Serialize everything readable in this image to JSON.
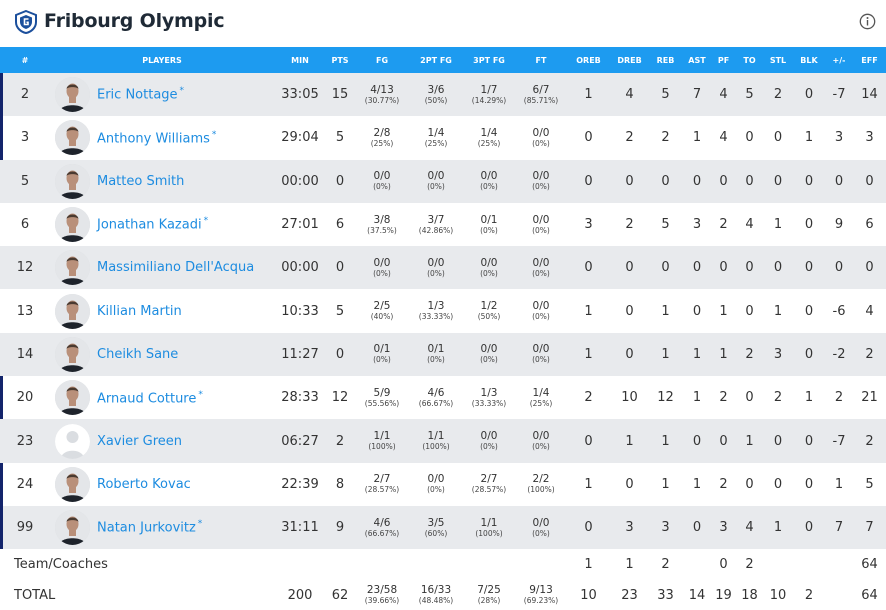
{
  "header": {
    "team_name": "Fribourg Olympic"
  },
  "columns": [
    "#",
    "PLAYERS",
    "MIN",
    "PTS",
    "FG",
    "2PT FG",
    "3PT FG",
    "FT",
    "OREB",
    "DREB",
    "REB",
    "AST",
    "PF",
    "TO",
    "STL",
    "BLK",
    "+/-",
    "EFF"
  ],
  "players": [
    {
      "no": "2",
      "name": "Eric Nottage",
      "starter": true,
      "star": "*",
      "min": "33:05",
      "pts": "15",
      "fg": "4/13",
      "fg_pct": "(30.77%)",
      "fg2": "3/6",
      "fg2_pct": "(50%)",
      "fg3": "1/7",
      "fg3_pct": "(14.29%)",
      "ft": "6/7",
      "ft_pct": "(85.71%)",
      "oreb": "1",
      "dreb": "4",
      "reb": "5",
      "ast": "7",
      "pf": "4",
      "to": "5",
      "stl": "2",
      "blk": "0",
      "pm": "-7",
      "eff": "14"
    },
    {
      "no": "3",
      "name": "Anthony Williams",
      "starter": true,
      "star": "*",
      "min": "29:04",
      "pts": "5",
      "fg": "2/8",
      "fg_pct": "(25%)",
      "fg2": "1/4",
      "fg2_pct": "(25%)",
      "fg3": "1/4",
      "fg3_pct": "(25%)",
      "ft": "0/0",
      "ft_pct": "(0%)",
      "oreb": "0",
      "dreb": "2",
      "reb": "2",
      "ast": "1",
      "pf": "4",
      "to": "0",
      "stl": "0",
      "blk": "1",
      "pm": "3",
      "eff": "3"
    },
    {
      "no": "5",
      "name": "Matteo Smith",
      "starter": false,
      "star": "",
      "min": "00:00",
      "pts": "0",
      "fg": "0/0",
      "fg_pct": "(0%)",
      "fg2": "0/0",
      "fg2_pct": "(0%)",
      "fg3": "0/0",
      "fg3_pct": "(0%)",
      "ft": "0/0",
      "ft_pct": "(0%)",
      "oreb": "0",
      "dreb": "0",
      "reb": "0",
      "ast": "0",
      "pf": "0",
      "to": "0",
      "stl": "0",
      "blk": "0",
      "pm": "0",
      "eff": "0"
    },
    {
      "no": "6",
      "name": "Jonathan Kazadi",
      "starter": false,
      "star": "*",
      "min": "27:01",
      "pts": "6",
      "fg": "3/8",
      "fg_pct": "(37.5%)",
      "fg2": "3/7",
      "fg2_pct": "(42.86%)",
      "fg3": "0/1",
      "fg3_pct": "(0%)",
      "ft": "0/0",
      "ft_pct": "(0%)",
      "oreb": "3",
      "dreb": "2",
      "reb": "5",
      "ast": "3",
      "pf": "2",
      "to": "4",
      "stl": "1",
      "blk": "0",
      "pm": "9",
      "eff": "6"
    },
    {
      "no": "12",
      "name": "Massimiliano Dell'Acqua",
      "starter": false,
      "star": "",
      "min": "00:00",
      "pts": "0",
      "fg": "0/0",
      "fg_pct": "(0%)",
      "fg2": "0/0",
      "fg2_pct": "(0%)",
      "fg3": "0/0",
      "fg3_pct": "(0%)",
      "ft": "0/0",
      "ft_pct": "(0%)",
      "oreb": "0",
      "dreb": "0",
      "reb": "0",
      "ast": "0",
      "pf": "0",
      "to": "0",
      "stl": "0",
      "blk": "0",
      "pm": "0",
      "eff": "0"
    },
    {
      "no": "13",
      "name": "Killian Martin",
      "starter": false,
      "star": "",
      "min": "10:33",
      "pts": "5",
      "fg": "2/5",
      "fg_pct": "(40%)",
      "fg2": "1/3",
      "fg2_pct": "(33.33%)",
      "fg3": "1/2",
      "fg3_pct": "(50%)",
      "ft": "0/0",
      "ft_pct": "(0%)",
      "oreb": "1",
      "dreb": "0",
      "reb": "1",
      "ast": "0",
      "pf": "1",
      "to": "0",
      "stl": "1",
      "blk": "0",
      "pm": "-6",
      "eff": "4"
    },
    {
      "no": "14",
      "name": "Cheikh Sane",
      "starter": false,
      "star": "",
      "min": "11:27",
      "pts": "0",
      "fg": "0/1",
      "fg_pct": "(0%)",
      "fg2": "0/1",
      "fg2_pct": "(0%)",
      "fg3": "0/0",
      "fg3_pct": "(0%)",
      "ft": "0/0",
      "ft_pct": "(0%)",
      "oreb": "1",
      "dreb": "0",
      "reb": "1",
      "ast": "1",
      "pf": "1",
      "to": "2",
      "stl": "3",
      "blk": "0",
      "pm": "-2",
      "eff": "2"
    },
    {
      "no": "20",
      "name": "Arnaud Cotture",
      "starter": true,
      "star": "*",
      "min": "28:33",
      "pts": "12",
      "fg": "5/9",
      "fg_pct": "(55.56%)",
      "fg2": "4/6",
      "fg2_pct": "(66.67%)",
      "fg3": "1/3",
      "fg3_pct": "(33.33%)",
      "ft": "1/4",
      "ft_pct": "(25%)",
      "oreb": "2",
      "dreb": "10",
      "reb": "12",
      "ast": "1",
      "pf": "2",
      "to": "0",
      "stl": "2",
      "blk": "1",
      "pm": "2",
      "eff": "21"
    },
    {
      "no": "23",
      "name": "Xavier Green",
      "starter": false,
      "star": "",
      "min": "06:27",
      "pts": "2",
      "fg": "1/1",
      "fg_pct": "(100%)",
      "fg2": "1/1",
      "fg2_pct": "(100%)",
      "fg3": "0/0",
      "fg3_pct": "(0%)",
      "ft": "0/0",
      "ft_pct": "(0%)",
      "oreb": "0",
      "dreb": "1",
      "reb": "1",
      "ast": "0",
      "pf": "0",
      "to": "1",
      "stl": "0",
      "blk": "0",
      "pm": "-7",
      "eff": "2",
      "placeholder_avatar": true
    },
    {
      "no": "24",
      "name": "Roberto Kovac",
      "starter": true,
      "star": "",
      "min": "22:39",
      "pts": "8",
      "fg": "2/7",
      "fg_pct": "(28.57%)",
      "fg2": "0/0",
      "fg2_pct": "(0%)",
      "fg3": "2/7",
      "fg3_pct": "(28.57%)",
      "ft": "2/2",
      "ft_pct": "(100%)",
      "oreb": "1",
      "dreb": "0",
      "reb": "1",
      "ast": "1",
      "pf": "2",
      "to": "0",
      "stl": "0",
      "blk": "0",
      "pm": "1",
      "eff": "5"
    },
    {
      "no": "99",
      "name": "Natan Jurkovitz",
      "starter": true,
      "star": "*",
      "min": "31:11",
      "pts": "9",
      "fg": "4/6",
      "fg_pct": "(66.67%)",
      "fg2": "3/5",
      "fg2_pct": "(60%)",
      "fg3": "1/1",
      "fg3_pct": "(100%)",
      "ft": "0/0",
      "ft_pct": "(0%)",
      "oreb": "0",
      "dreb": "3",
      "reb": "3",
      "ast": "0",
      "pf": "3",
      "to": "4",
      "stl": "1",
      "blk": "0",
      "pm": "7",
      "eff": "7"
    }
  ],
  "team_coaches": {
    "label": "Team/Coaches",
    "oreb": "1",
    "dreb": "1",
    "reb": "2",
    "ast": "",
    "pf": "0",
    "to": "2",
    "stl": "",
    "blk": "",
    "pm": "",
    "eff": "64"
  },
  "total": {
    "label": "TOTAL",
    "min": "200",
    "pts": "62",
    "fg": "23/58",
    "fg_pct": "(39.66%)",
    "fg2": "16/33",
    "fg2_pct": "(48.48%)",
    "fg3": "7/25",
    "fg3_pct": "(28%)",
    "ft": "9/13",
    "ft_pct": "(69.23%)",
    "oreb": "10",
    "dreb": "23",
    "reb": "33",
    "ast": "14",
    "pf": "19",
    "to": "18",
    "stl": "10",
    "blk": "2",
    "pm": "",
    "eff": "64"
  },
  "colors": {
    "header_blue": "#1d9bf0",
    "link_blue": "#1d8ce0",
    "starter_bar": "#13246b",
    "row_alt": "#e8eaed"
  }
}
